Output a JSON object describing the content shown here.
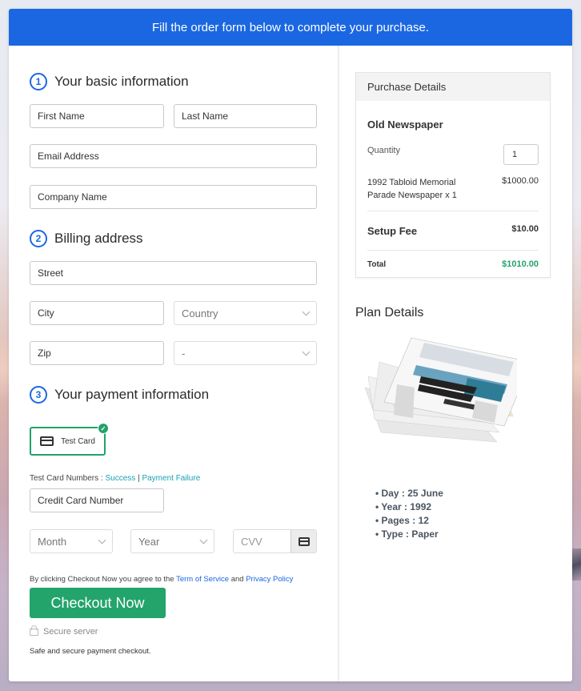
{
  "banner": {
    "text": "Fill the order form below to complete your purchase."
  },
  "form": {
    "basic_info": {
      "step": "1",
      "title": "Your basic information",
      "first_name_placeholder": "First Name",
      "last_name_placeholder": "Last Name",
      "email_placeholder": "Email Address",
      "company_placeholder": "Company Name"
    },
    "billing": {
      "step": "2",
      "title": "Billing address",
      "street_placeholder": "Street",
      "city_placeholder": "City",
      "country_value": "Country",
      "zip_placeholder": "Zip",
      "state_value": "-"
    },
    "payment": {
      "step": "3",
      "title": "Your payment information",
      "method_label": "Test Card",
      "test_numbers_label": "Test Card Numbers :",
      "success_link": "Success",
      "separator": "|",
      "failure_link": "Payment Failure",
      "card_number_placeholder": "Credit Card Number",
      "month_value": "Month",
      "year_value": "Year",
      "cvv_placeholder": "CVV"
    },
    "terms": {
      "prefix": "By clicking Checkout Now you agree to the",
      "tos_link": "Term of Service",
      "and": "and",
      "privacy_link": "Privacy Policy"
    },
    "checkout_label": "Checkout Now",
    "secure_label": "Secure server",
    "safe_note": "Safe and secure payment checkout."
  },
  "purchase": {
    "header": "Purchase Details",
    "product": "Old Newspaper",
    "quantity_label": "Quantity",
    "quantity_value": "1",
    "line_item_1": "1992 Tabloid Memorial",
    "line_item_2": "Parade Newspaper x 1",
    "line_price": "$1000.00",
    "setup_fee_label": "Setup Fee",
    "setup_fee_value": "$10.00",
    "total_label": "Total",
    "total_value": "$1010.00"
  },
  "plan": {
    "title": "Plan Details",
    "details": [
      "Day : 25 June",
      "Year : 1992",
      "Pages : 12",
      "Type : Paper"
    ]
  },
  "colors": {
    "primary": "#1b67e2",
    "success": "#22a46b",
    "link": "#1aa0b5",
    "total": "#23a26b"
  }
}
